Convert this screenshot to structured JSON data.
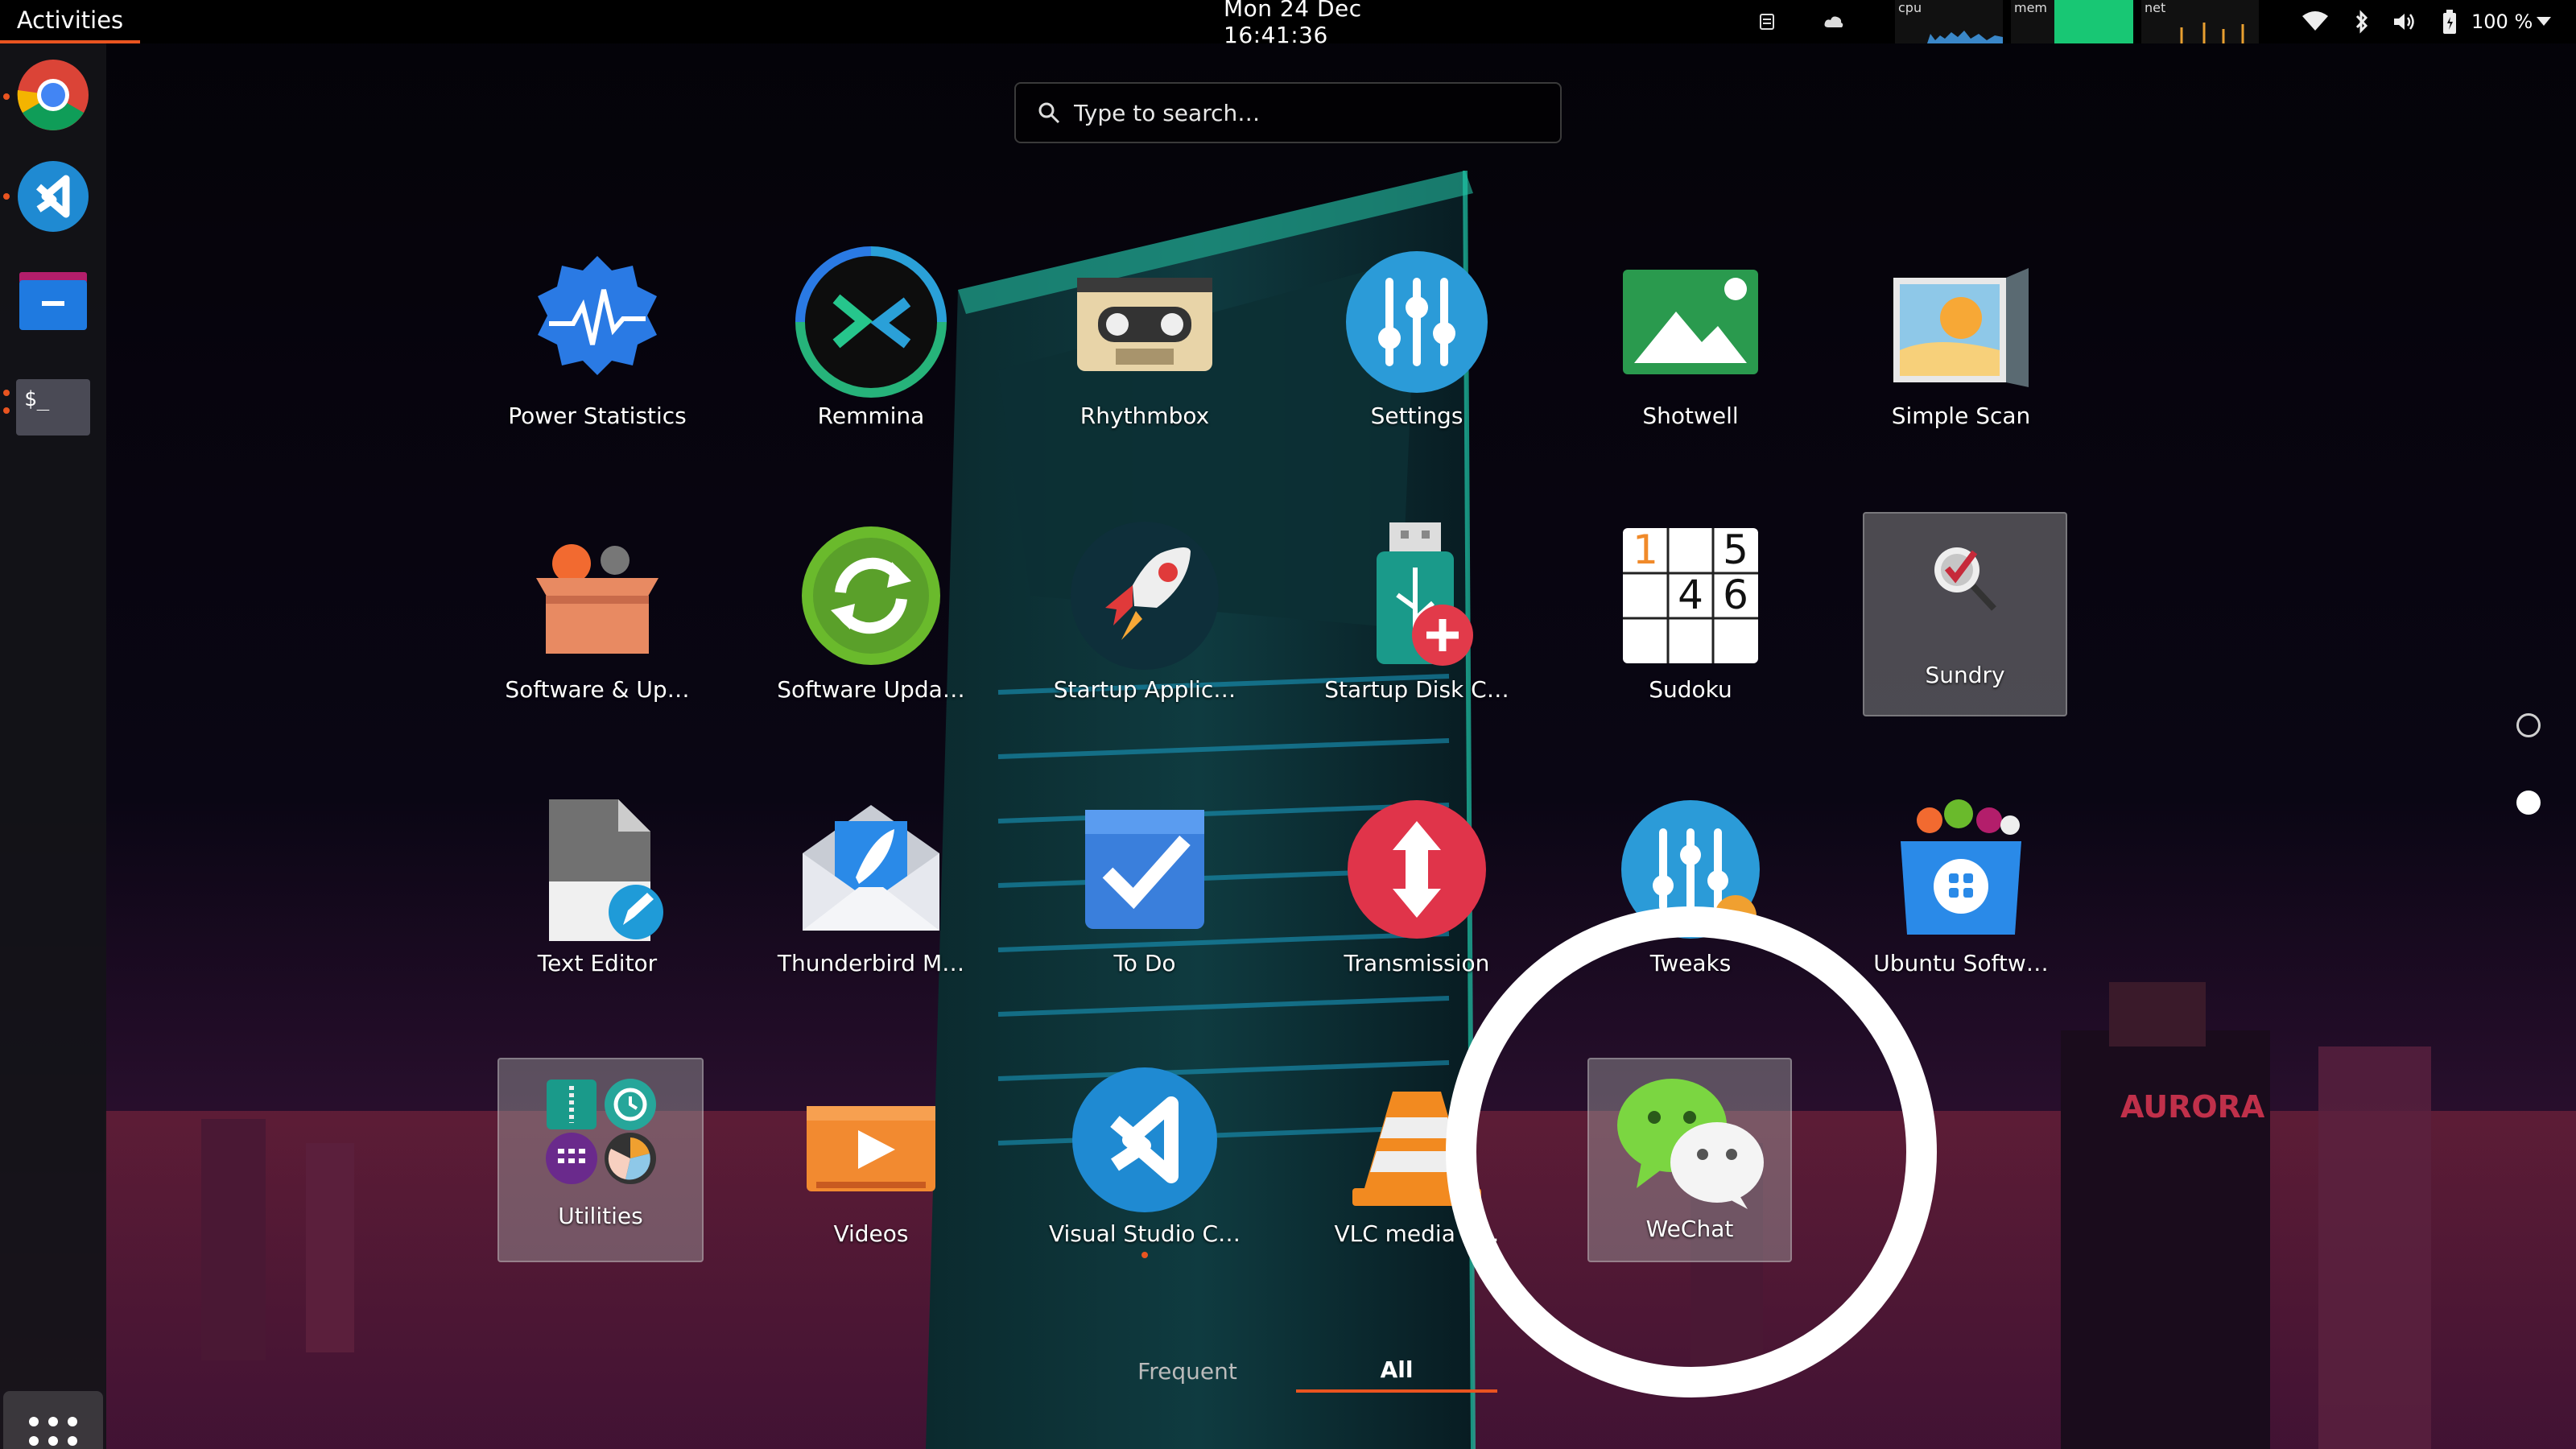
{
  "topbar": {
    "activities_label": "Activities",
    "clock": "Mon 24 Dec  16:41:36",
    "sysmon": {
      "cpu_label": "cpu",
      "mem_label": "mem",
      "net_label": "net"
    },
    "battery_text": "100 %",
    "tray_icons": [
      "tray-app-icon",
      "tray-cloud-icon",
      "wifi-icon",
      "bluetooth-icon",
      "volume-icon",
      "battery-icon",
      "chevron-down-icon"
    ]
  },
  "dock": {
    "items": [
      {
        "name": "chrome",
        "icon": "chrome-icon",
        "running": true
      },
      {
        "name": "vscode",
        "icon": "vscode-icon",
        "running": true
      },
      {
        "name": "files",
        "icon": "files-icon",
        "running": false
      },
      {
        "name": "terminal",
        "icon": "terminal-icon",
        "running": true,
        "glyph": "$_"
      }
    ],
    "show_apps_icon": "grid-icon"
  },
  "search": {
    "placeholder": "Type to search…"
  },
  "apps": {
    "power_statistics": "Power Statistics",
    "remmina": "Remmina",
    "rhythmbox": "Rhythmbox",
    "settings": "Settings",
    "shotwell": "Shotwell",
    "simple_scan": "Simple Scan",
    "software_up": "Software & Up…",
    "software_upda": "Software Upda…",
    "startup_applic": "Startup Applic…",
    "startup_disk": "Startup Disk C…",
    "sudoku": "Sudoku",
    "sundry": "Sundry",
    "text_editor": "Text Editor",
    "thunderbird": "Thunderbird M…",
    "to_do": "To Do",
    "transmission": "Transmission",
    "tweaks": "Tweaks",
    "ubuntu_software": "Ubuntu Softw…",
    "utilities": "Utilities",
    "videos": "Videos",
    "visual_studio": "Visual Studio C…",
    "vlc": "VLC media p…",
    "wechat": "WeChat"
  },
  "sudoku_digits": [
    "1",
    "5",
    "4",
    "6"
  ],
  "tabs": {
    "frequent": "Frequent",
    "all": "All"
  },
  "wallpaper_sign": "AURORA",
  "colors": {
    "accent": "#e95420",
    "settings_blue": "#2b9bd8",
    "wechat_green": "#7bd641"
  }
}
